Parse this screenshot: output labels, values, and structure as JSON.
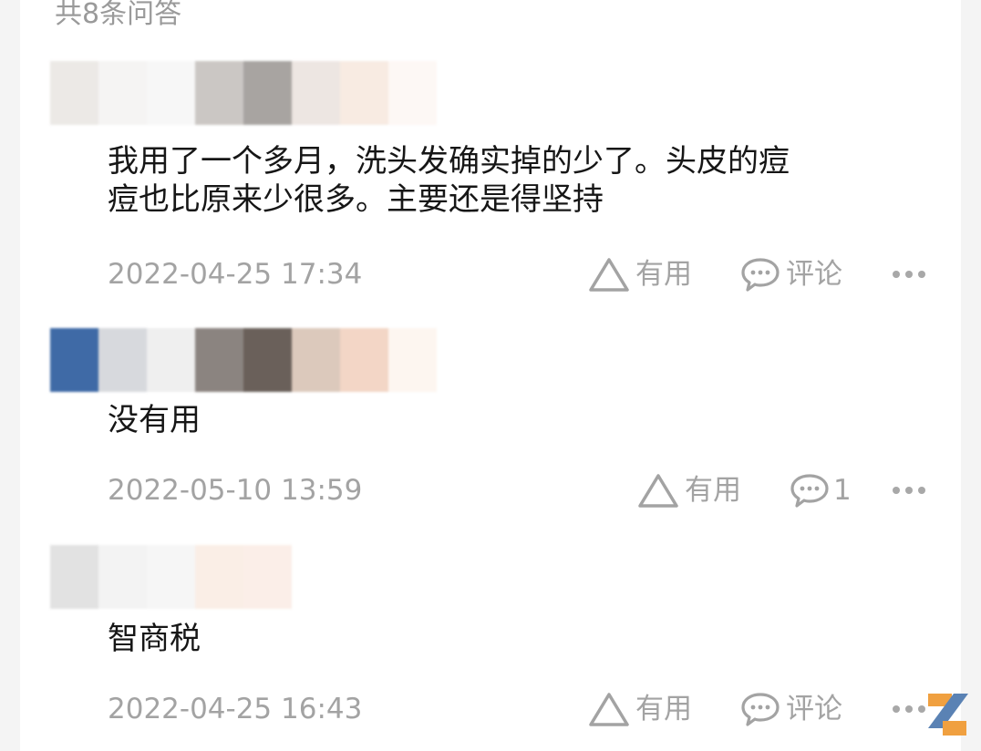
{
  "header": {
    "count_label": "共8条问答"
  },
  "answers": [
    {
      "text_lines": [
        "我用了一个多月，洗头发确实掉的少了。头皮的痘",
        "痘也比原来少很多。主要还是得坚持"
      ],
      "timestamp": "2022-04-25 17:34",
      "useful_label": "有用",
      "comment_label": "评论"
    },
    {
      "text_lines": [
        "没有用"
      ],
      "timestamp": "2022-05-10 13:59",
      "useful_label": "有用",
      "comment_label": "1"
    },
    {
      "text_lines": [
        "智商税"
      ],
      "timestamp": "2022-04-25 16:43",
      "useful_label": "有用",
      "comment_label": "评论"
    }
  ],
  "icons": {
    "useful": "triangle-outline-icon",
    "comment": "speech-bubble-icon",
    "more": "more-dots-icon",
    "logo": "watermark-logo-icon"
  },
  "colors": {
    "meta_text": "#a3a3a3",
    "body_text": "#161616",
    "logo_orange": "#f0a040",
    "logo_blue": "#5a82b4"
  },
  "avatar_blur_colors": [
    [
      "#ece9e6",
      "#f5f4f3",
      "#f7f7f7",
      "#cbc7c4",
      "#a8a4a1",
      "#ede6e2",
      "#f8ebe2",
      "#fdf8f5"
    ],
    [
      "#3f6aa6",
      "#d7d9dd",
      "#efefef",
      "#8b8480",
      "#6a605a",
      "#dcc9bc",
      "#f3d6c6",
      "#fdf6f0"
    ],
    [
      "#e2e2e2",
      "#f3f3f3",
      "#f6f6f6",
      "#faeee6",
      "#fbeee8"
    ]
  ]
}
